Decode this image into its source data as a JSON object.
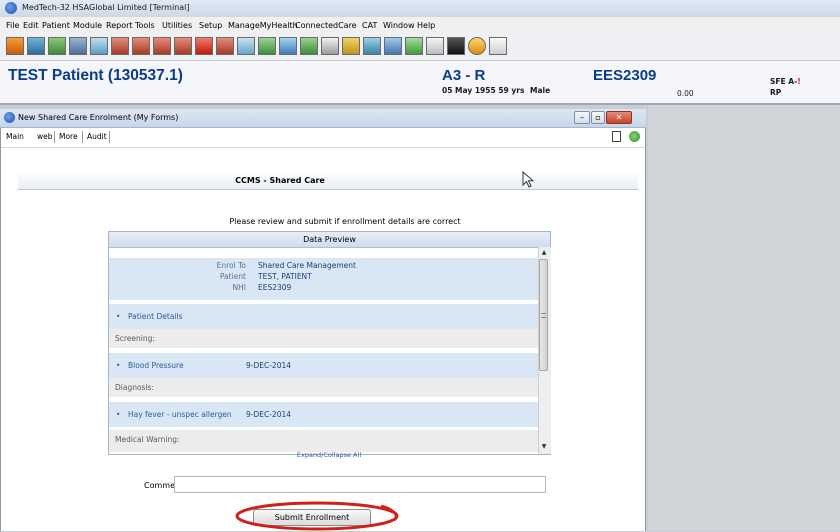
{
  "app": {
    "title": "MedTech-32 HSAGlobal Limited [Terminal]"
  },
  "menu": [
    "File",
    "Edit",
    "Patient",
    "Module",
    "Report",
    "Tools",
    "Utilities",
    "Setup",
    "ManageMyHealth",
    "ConnectedCare",
    "CAT",
    "Window",
    "Help"
  ],
  "patient": {
    "name": "TEST Patient (130537.1)",
    "code": "A3 - R",
    "nhi": "EES2309",
    "dob_age": "05 May 1955 59 yrs",
    "gender": "Male",
    "balance": "0.00",
    "sfe": "SFE A-",
    "sfe_flag": "!",
    "rp": "RP"
  },
  "child_window": {
    "title": "New Shared Care Enrolment (My Forms)",
    "tabs": [
      "Main",
      "web",
      "More",
      "Audit"
    ]
  },
  "form": {
    "header": "CCMS - Shared Care",
    "review_message": "Please review and submit if enrollment details are correct",
    "preview_title": "Data Preview",
    "enrol_to_label": "Enrol To",
    "enrol_to_value": "Shared Care Management",
    "patient_label": "Patient",
    "patient_value": "TEST, PATIENT",
    "nhi_label": "NHI",
    "nhi_value": "EES2309",
    "patient_details": "Patient Details",
    "screening_label": "Screening:",
    "bp_label": "Blood Pressure",
    "bp_date": "9-DEC-2014",
    "diagnosis_label": "Diagnosis:",
    "hay_fever_label": "Hay fever - unspec allergen",
    "hay_fever_date": "9-DEC-2014",
    "medical_warning_label": "Medical Warning:",
    "expand_collapse": "Expand/Collapse All",
    "comments_label": "Comments",
    "comments_value": "",
    "submit_label": "Submit Enrollment"
  },
  "icons": {
    "bullet": "•",
    "scroll_up": "▲",
    "scroll_down": "▼",
    "minimize": "–",
    "restore": "▫",
    "close": "✕"
  },
  "colors": {
    "patient_header_text": "#0a3c8a",
    "highlight_circle": "#d0201a",
    "preview_band": "#d9e6f4"
  }
}
